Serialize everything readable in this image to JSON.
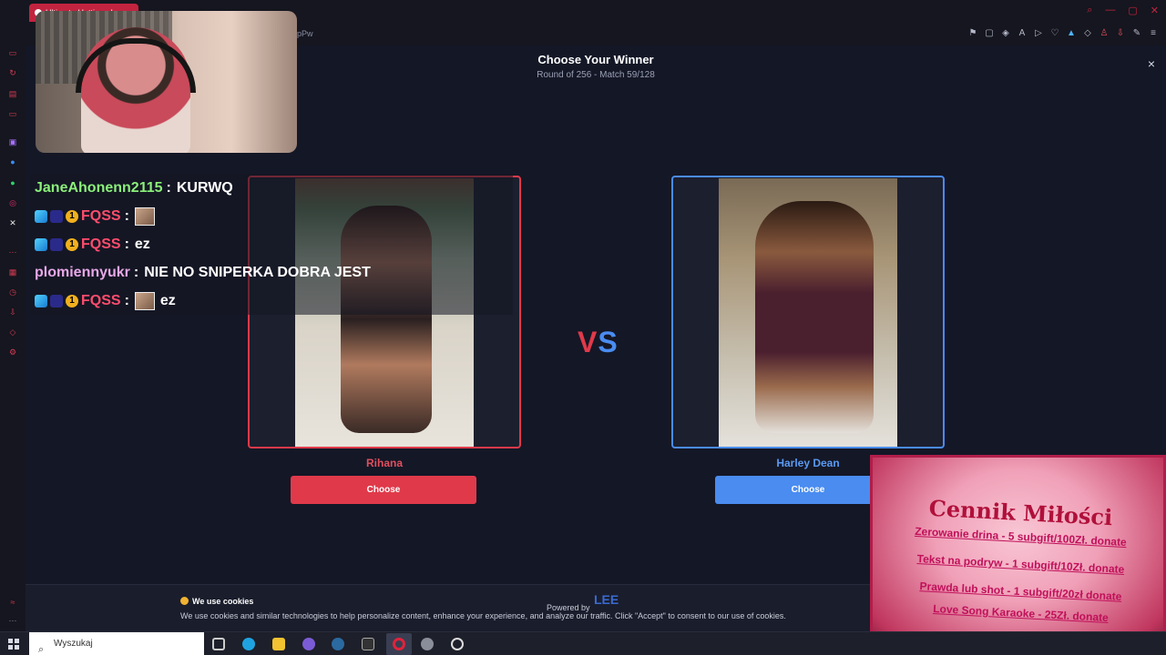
{
  "browser": {
    "tab_title": "Ultimate Hotties - Leey...",
    "url_fragment": "pPw",
    "toolbar_icons": [
      "bookmark-icon",
      "snapshot-icon",
      "shield-icon",
      "translate-icon",
      "play-icon",
      "heart-icon",
      "extension-icon",
      "puzzle-icon",
      "user-icon",
      "download-icon",
      "ai-icon",
      "menu-icon"
    ]
  },
  "modal": {
    "title": "Choose Your Winner",
    "subtitle": "Round of 256 - Match 59/128",
    "close_symbol": "×"
  },
  "contestants": [
    {
      "name": "Rihana",
      "accent": "#e03a4a",
      "choose_label": "Choose"
    },
    {
      "name": "Harley Dean",
      "accent": "#4a8cf0",
      "choose_label": "Choose"
    }
  ],
  "versus": {
    "v": "V",
    "s": "S"
  },
  "cookies": {
    "title": "We use cookies",
    "text": "We use cookies and similar technologies to help personalize content, enhance your experience, and analyze our traffic. Click \"Accept\" to consent to our use of cookies.",
    "powered_by": "Powered by",
    "logo_text": "LEE"
  },
  "chat": [
    {
      "user": "JaneAhonenn2115",
      "message": "KURWQ",
      "color": "green",
      "badges": false,
      "emote": false
    },
    {
      "user": "FQSS",
      "message": "",
      "color": "red",
      "badges": true,
      "emote": true
    },
    {
      "user": "FQSS",
      "message": "ez",
      "color": "red",
      "badges": true,
      "emote": false
    },
    {
      "user": "plomiennyukr",
      "message": "NIE NO SNIPERKA DOBRA JEST",
      "color": "pink",
      "badges": false,
      "emote": false
    },
    {
      "user": "FQSS",
      "message": "ez",
      "color": "red",
      "badges": true,
      "emote": true
    }
  ],
  "promo": {
    "title": "Cennik Miłości",
    "lines": [
      "Zerowanie drina - 5 subgift/100Zł. donate",
      "Tekst na podryw - 1 subgift/10Zł. donate",
      "Prawda lub shot - 1 subgift/20zł donate",
      "Love Song Karaoke - 25Zł. donate"
    ]
  },
  "taskbar": {
    "search_placeholder": "Wyszukaj"
  },
  "colors": {
    "red": "#e03a4a",
    "blue": "#4a8cf0",
    "background": "#141726"
  }
}
